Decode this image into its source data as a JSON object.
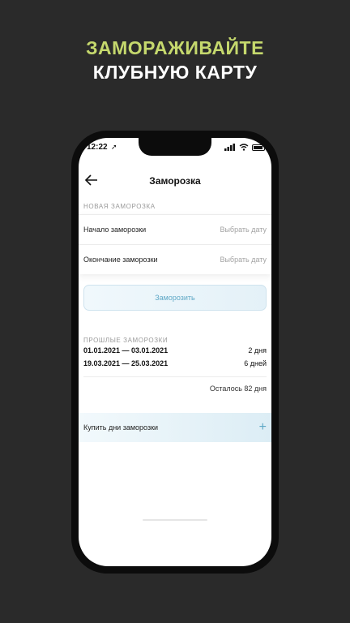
{
  "promo": {
    "line1": "ЗАМОРАЖИВАЙТЕ",
    "line2": "КЛУБНУЮ КАРТУ"
  },
  "status_bar": {
    "time": "12:22",
    "location_icon": "location-arrow-icon",
    "signal_icon": "signal-icon",
    "wifi_icon": "wifi-icon",
    "battery_icon": "battery-icon"
  },
  "header": {
    "back_icon": "arrow-left-icon",
    "title": "Заморозка"
  },
  "new_freeze": {
    "section_label": "НОВАЯ ЗАМОРОЗКА",
    "rows": [
      {
        "label": "Начало заморозки",
        "value": "Выбрать дату"
      },
      {
        "label": "Окончание заморозки",
        "value": "Выбрать дату"
      }
    ],
    "button_label": "Заморозить"
  },
  "past_freezes": {
    "section_label": "ПРОШЛЫЕ ЗАМОРОЗКИ",
    "items": [
      {
        "dates": "01.01.2021 — 03.01.2021",
        "duration": "2 дня"
      },
      {
        "dates": "19.03.2021 — 25.03.2021",
        "duration": "6 дней"
      }
    ],
    "remaining": "Осталось 82 дня"
  },
  "buy": {
    "label": "Купить дни заморозки",
    "plus_icon": "plus-icon"
  },
  "colors": {
    "background": "#2a2a2a",
    "promo_accent": "#c5d86d",
    "button_text": "#5fa8c6"
  }
}
